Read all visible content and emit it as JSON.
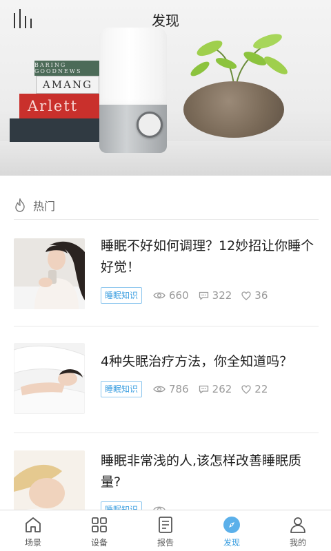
{
  "header": {
    "title": "发现"
  },
  "hero": {
    "book_titles": [
      "BARING  GOODNEWS",
      "AMANG",
      "Arlett",
      ""
    ]
  },
  "section": {
    "title": "热门"
  },
  "articles": [
    {
      "title_line1": "睡眠不好如何调理？12妙招让你睡个",
      "title_line2": "好觉！",
      "tag": "睡眠知识",
      "views": "660",
      "comments": "322",
      "likes": "36"
    },
    {
      "title_line1": "4种失眠治疗方法，你全知道吗？",
      "title_line2": "",
      "tag": "睡眠知识",
      "views": "786",
      "comments": "262",
      "likes": "22"
    },
    {
      "title_line1": "睡眠非常浅的人,该怎样改善睡眠质",
      "title_line2": "量?",
      "tag": "睡眠知识",
      "views": "",
      "comments": "",
      "likes": ""
    }
  ],
  "nav": {
    "items": [
      {
        "label": "场景",
        "icon": "home-icon",
        "active": false
      },
      {
        "label": "设备",
        "icon": "grid-icon",
        "active": false
      },
      {
        "label": "报告",
        "icon": "document-icon",
        "active": false
      },
      {
        "label": "发现",
        "icon": "compass-icon",
        "active": true
      },
      {
        "label": "我的",
        "icon": "user-icon",
        "active": false
      }
    ]
  },
  "colors": {
    "accent": "#3a9ee0",
    "text": "#222222",
    "muted": "#999999"
  }
}
